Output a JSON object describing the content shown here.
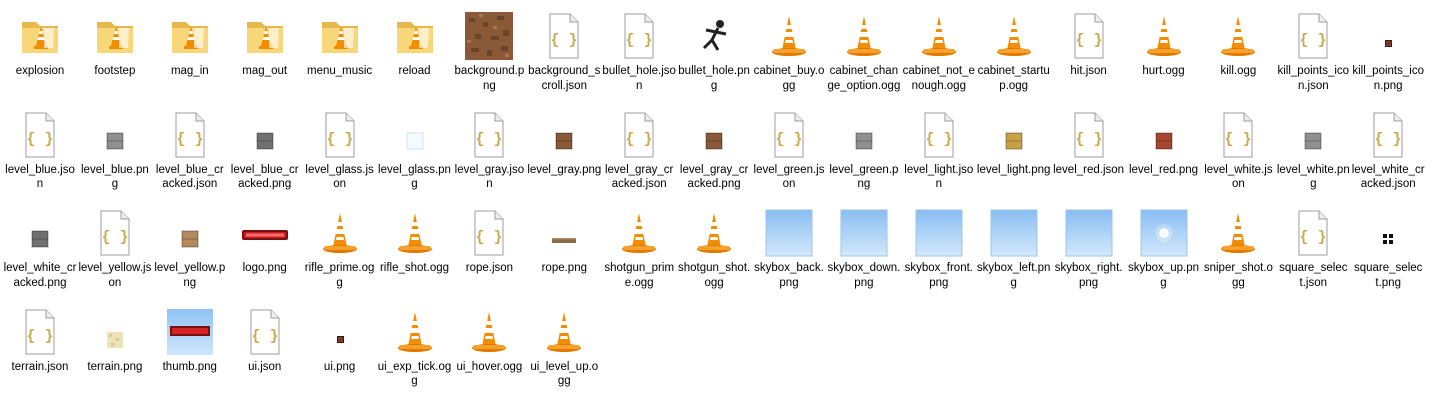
{
  "colors": {
    "background": "#ffffff",
    "text": "#000000",
    "folder": "#f3cf6f",
    "cone_orange": "#f28c00",
    "cone_white": "#ffffff",
    "json_brace": "#c7a94a",
    "sky_blue": "#8fc3f3"
  },
  "files": [
    {
      "name": "explosion",
      "icon": "folder-vlc-icon"
    },
    {
      "name": "footstep",
      "icon": "folder-vlc-icon"
    },
    {
      "name": "mag_in",
      "icon": "folder-vlc-icon"
    },
    {
      "name": "mag_out",
      "icon": "folder-vlc-icon"
    },
    {
      "name": "menu_music",
      "icon": "folder-vlc-icon"
    },
    {
      "name": "reload",
      "icon": "folder-vlc-icon"
    },
    {
      "name": "background.png",
      "icon": "dirt-image-icon"
    },
    {
      "name": "background_scroll.json",
      "icon": "json-file-icon"
    },
    {
      "name": "bullet_hole.json",
      "icon": "json-file-icon"
    },
    {
      "name": "bullet_hole.png",
      "icon": "stickman-image-icon"
    },
    {
      "name": "cabinet_buy.ogg",
      "icon": "vlc-cone-icon"
    },
    {
      "name": "cabinet_change_option.ogg",
      "icon": "vlc-cone-icon"
    },
    {
      "name": "cabinet_not_enough.ogg",
      "icon": "vlc-cone-icon"
    },
    {
      "name": "cabinet_startup.ogg",
      "icon": "vlc-cone-icon"
    },
    {
      "name": "hit.json",
      "icon": "json-file-icon"
    },
    {
      "name": "hurt.ogg",
      "icon": "vlc-cone-icon"
    },
    {
      "name": "kill.ogg",
      "icon": "vlc-cone-icon"
    },
    {
      "name": "kill_points_icon.json",
      "icon": "json-file-icon"
    },
    {
      "name": "kill_points_icon.png",
      "icon": "tiny-image-icon"
    },
    {
      "name": "level_blue.json",
      "icon": "json-file-icon"
    },
    {
      "name": "level_blue.png",
      "icon": "gray-tile-image-icon"
    },
    {
      "name": "level_blue_cracked.json",
      "icon": "json-file-icon"
    },
    {
      "name": "level_blue_cracked.png",
      "icon": "cracked-tile-image-icon"
    },
    {
      "name": "level_glass.json",
      "icon": "json-file-icon"
    },
    {
      "name": "level_glass.png",
      "icon": "glass-image-icon"
    },
    {
      "name": "level_gray.json",
      "icon": "json-file-icon"
    },
    {
      "name": "level_gray.png",
      "icon": "brown-tile-image-icon"
    },
    {
      "name": "level_gray_cracked.json",
      "icon": "json-file-icon"
    },
    {
      "name": "level_gray_cracked.png",
      "icon": "brown-tile-image-icon"
    },
    {
      "name": "level_green.json",
      "icon": "json-file-icon"
    },
    {
      "name": "level_green.png",
      "icon": "gray-tile-image-icon"
    },
    {
      "name": "level_light.json",
      "icon": "json-file-icon"
    },
    {
      "name": "level_light.png",
      "icon": "gold-tile-image-icon"
    },
    {
      "name": "level_red.json",
      "icon": "json-file-icon"
    },
    {
      "name": "level_red.png",
      "icon": "brick-tile-image-icon"
    },
    {
      "name": "level_white.json",
      "icon": "json-file-icon"
    },
    {
      "name": "level_white.png",
      "icon": "gray-tile-image-icon"
    },
    {
      "name": "level_white_cracked.json",
      "icon": "json-file-icon"
    },
    {
      "name": "level_white_cracked.png",
      "icon": "cracked-tile-image-icon"
    },
    {
      "name": "level_yellow.json",
      "icon": "json-file-icon"
    },
    {
      "name": "level_yellow.png",
      "icon": "wood-tile-image-icon"
    },
    {
      "name": "logo.png",
      "icon": "logo-image-icon"
    },
    {
      "name": "rifle_prime.ogg",
      "icon": "vlc-cone-icon"
    },
    {
      "name": "rifle_shot.ogg",
      "icon": "vlc-cone-icon"
    },
    {
      "name": "rope.json",
      "icon": "json-file-icon"
    },
    {
      "name": "rope.png",
      "icon": "rope-image-icon"
    },
    {
      "name": "shotgun_prime.ogg",
      "icon": "vlc-cone-icon"
    },
    {
      "name": "shotgun_shot.ogg",
      "icon": "vlc-cone-icon"
    },
    {
      "name": "skybox_back.png",
      "icon": "skybox-image-icon"
    },
    {
      "name": "skybox_down.png",
      "icon": "skybox-image-icon"
    },
    {
      "name": "skybox_front.png",
      "icon": "skybox-image-icon"
    },
    {
      "name": "skybox_left.png",
      "icon": "skybox-image-icon"
    },
    {
      "name": "skybox_right.png",
      "icon": "skybox-image-icon"
    },
    {
      "name": "skybox_up.png",
      "icon": "skybox-sun-image-icon"
    },
    {
      "name": "sniper_shot.ogg",
      "icon": "vlc-cone-icon"
    },
    {
      "name": "square_select.json",
      "icon": "json-file-icon"
    },
    {
      "name": "square_select.png",
      "icon": "select-image-icon"
    },
    {
      "name": "terrain.json",
      "icon": "json-file-icon"
    },
    {
      "name": "terrain.png",
      "icon": "sand-tile-image-icon"
    },
    {
      "name": "thumb.png",
      "icon": "thumb-image-icon"
    },
    {
      "name": "ui.json",
      "icon": "json-file-icon"
    },
    {
      "name": "ui.png",
      "icon": "tiny-dark-image-icon"
    },
    {
      "name": "ui_exp_tick.ogg",
      "icon": "vlc-cone-icon"
    },
    {
      "name": "ui_hover.ogg",
      "icon": "vlc-cone-icon"
    },
    {
      "name": "ui_level_up.ogg",
      "icon": "vlc-cone-icon"
    }
  ]
}
